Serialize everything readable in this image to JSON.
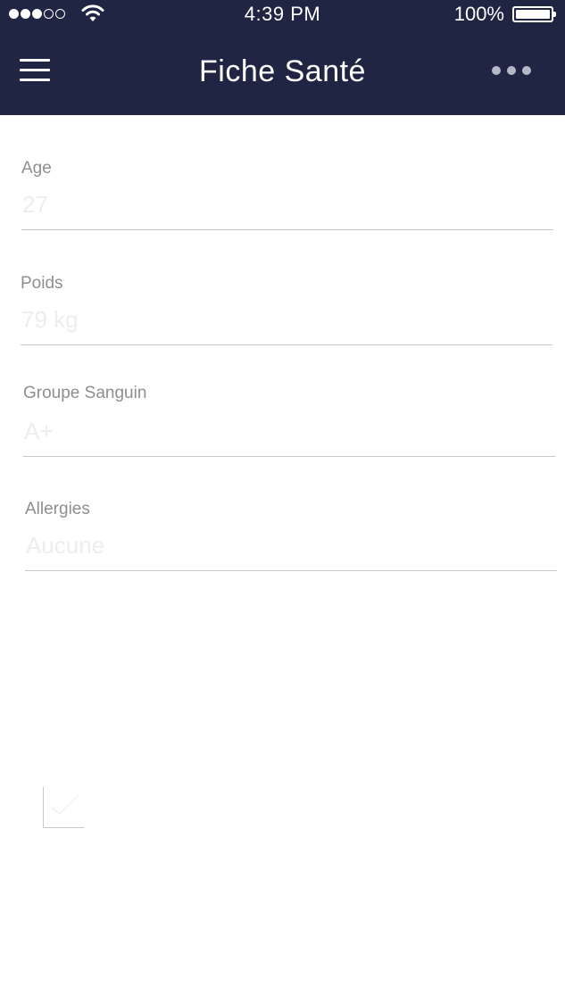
{
  "status_bar": {
    "time": "4:39 PM",
    "battery_percent": "100%",
    "signal_bars_filled": 3,
    "signal_bars_total": 5
  },
  "nav": {
    "title": "Fiche Santé",
    "menu_icon": "hamburger-menu-icon",
    "more_icon": "more-dots-icon"
  },
  "form": {
    "fields": [
      {
        "label": "Age",
        "value": "27"
      },
      {
        "label": "Poids",
        "value": "79 kg"
      },
      {
        "label": "Groupe Sanguin",
        "value": "A+"
      },
      {
        "label": "Allergies",
        "value": "Aucune"
      }
    ]
  },
  "checkbox": {
    "icon": "checkmark-icon"
  },
  "colors": {
    "header_bg": "#1f2543",
    "label": "#8e8e93",
    "value": "#ededf0",
    "divider": "#c9c9cc"
  }
}
